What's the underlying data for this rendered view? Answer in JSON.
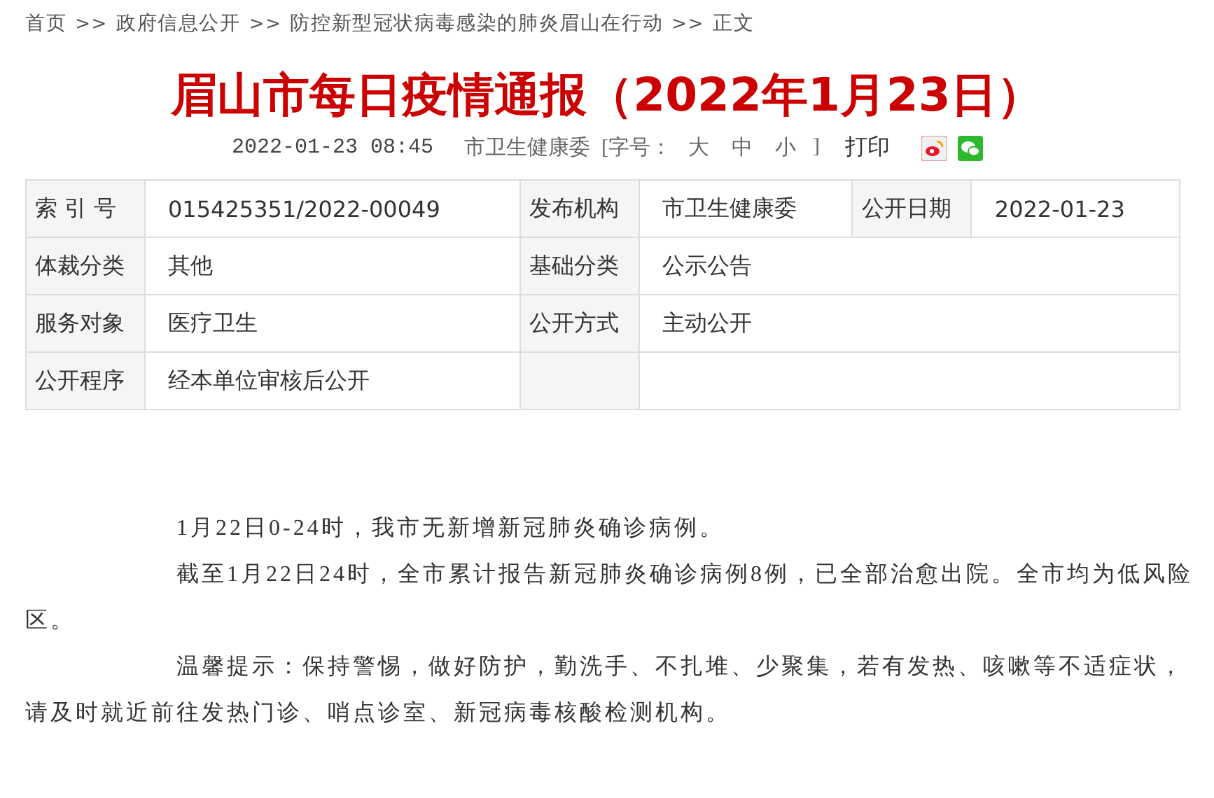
{
  "breadcrumb": [
    {
      "label": "首页",
      "separator": ">>"
    },
    {
      "label": "政府信息公开",
      "separator": ">>"
    },
    {
      "label": "防控新型冠状病毒感染的肺炎眉山在行动",
      "separator": ">>"
    },
    {
      "label": "正文"
    }
  ],
  "title": "眉山市每日疫情通报（2022年1月23日）",
  "meta": {
    "datetime": "2022-01-23 08:45",
    "source": "市卫生健康委",
    "font_size_label": "[字号：",
    "font_sizes": [
      "大",
      "中",
      "小"
    ],
    "font_size_close": "]",
    "print": "打印"
  },
  "info_table": [
    [
      {
        "label": "索 引 号",
        "value": "015425351/2022-00049"
      },
      {
        "label": "发布机构",
        "value": "市卫生健康委"
      },
      {
        "label": "公开日期",
        "value": "2022-01-23"
      }
    ],
    [
      {
        "label": "体裁分类",
        "value": "其他"
      },
      {
        "label": "基础分类",
        "value": "公示公告"
      }
    ],
    [
      {
        "label": "服务对象",
        "value": "医疗卫生"
      },
      {
        "label": "公开方式",
        "value": "主动公开"
      }
    ],
    [
      {
        "label": "公开程序",
        "value": "经本单位审核后公开"
      }
    ]
  ],
  "paragraphs": [
    "1月22日0-24时，我市无新增新冠肺炎确诊病例。",
    "截至1月22日24时，全市累计报告新冠肺炎确诊病例8例，已全部治愈出院。全市均为低风险区。",
    "温馨提示：保持警惕，做好防护，勤洗手、不扎堆、少聚集，若有发热、咳嗽等不适症状，请及时就近前往发热门诊、哨点诊室、新冠病毒核酸检测机构。"
  ]
}
